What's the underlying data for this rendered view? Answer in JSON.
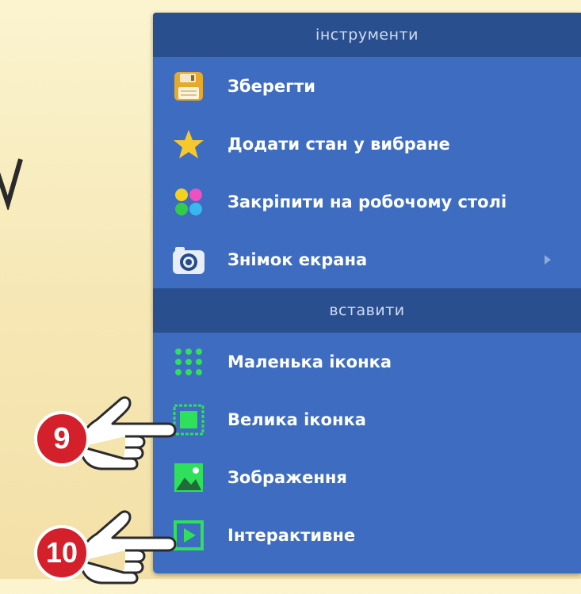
{
  "menu": {
    "sections": [
      {
        "header": "інструменти",
        "items": [
          {
            "label": "Зберегти",
            "icon": "floppy-disk-icon"
          },
          {
            "label": "Додати стан у вибране",
            "icon": "star-icon"
          },
          {
            "label": "Закріпити на робочому столі",
            "icon": "colored-dots-icon"
          },
          {
            "label": "Знімок екрана",
            "icon": "camera-icon",
            "has_submenu": true
          }
        ]
      },
      {
        "header": "вставити",
        "items": [
          {
            "label": "Маленька іконка",
            "icon": "small-icon-grid-icon"
          },
          {
            "label": "Велика іконка",
            "icon": "large-icon-frame-icon"
          },
          {
            "label": "Зображення",
            "icon": "image-icon"
          },
          {
            "label": "Інтерактивне",
            "icon": "play-frame-icon"
          }
        ]
      }
    ]
  },
  "callouts": [
    {
      "number": "9",
      "target": "Велика іконка"
    },
    {
      "number": "10",
      "target": "Інтерактивне"
    }
  ],
  "colors": {
    "menu_bg": "#3d6cc0",
    "header_bg": "#2a4f8f",
    "accent_green": "#2ee05a",
    "badge_red": "#d3202a"
  }
}
